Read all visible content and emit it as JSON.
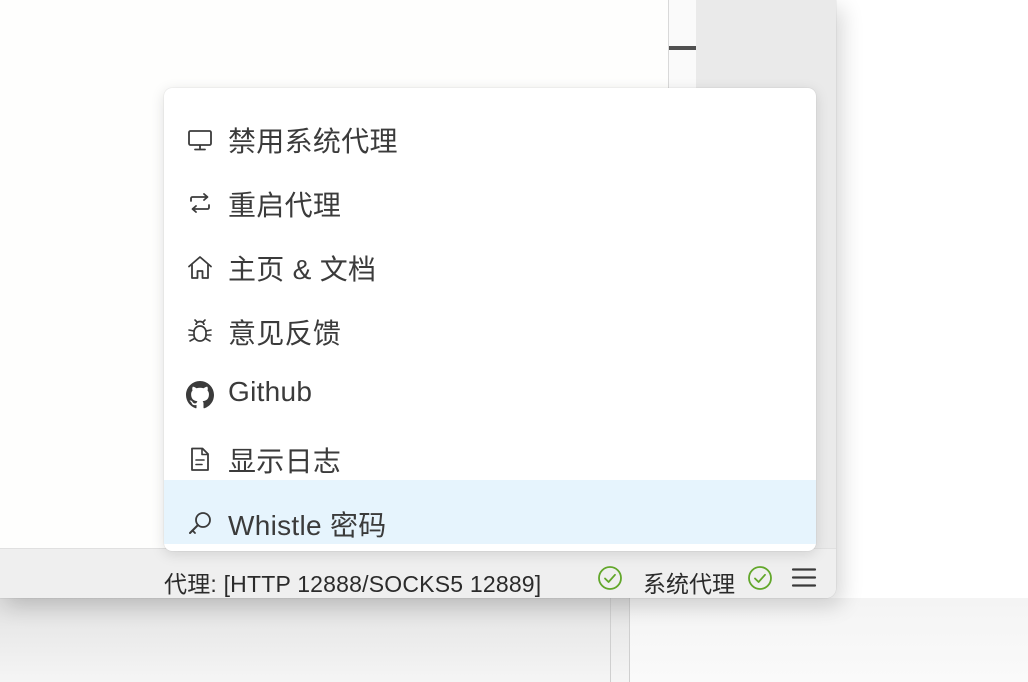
{
  "menu": {
    "items": [
      {
        "label": "禁用系统代理",
        "icon": "monitor-icon"
      },
      {
        "label": "重启代理",
        "icon": "swap-icon"
      },
      {
        "label": "主页 & 文档",
        "icon": "home-icon"
      },
      {
        "label": "意见反馈",
        "icon": "bug-icon"
      },
      {
        "label": "Github",
        "icon": "github-icon"
      },
      {
        "label": "显示日志",
        "icon": "file-text-icon"
      },
      {
        "label": "Whistle 密码",
        "icon": "key-icon",
        "highlighted": true
      }
    ]
  },
  "status_bar": {
    "proxy_text": "代理: [HTTP 12888/SOCKS5 12889]",
    "system_proxy_text": "系统代理",
    "proxy_ok_icon": "check-circle-icon",
    "system_proxy_ok_icon": "check-circle-icon",
    "menu_icon": "hamburger-menu-icon"
  },
  "colors": {
    "status_ok": "#62a72a",
    "highlight": "#e6f4fd",
    "text": "#3b3b3b"
  }
}
